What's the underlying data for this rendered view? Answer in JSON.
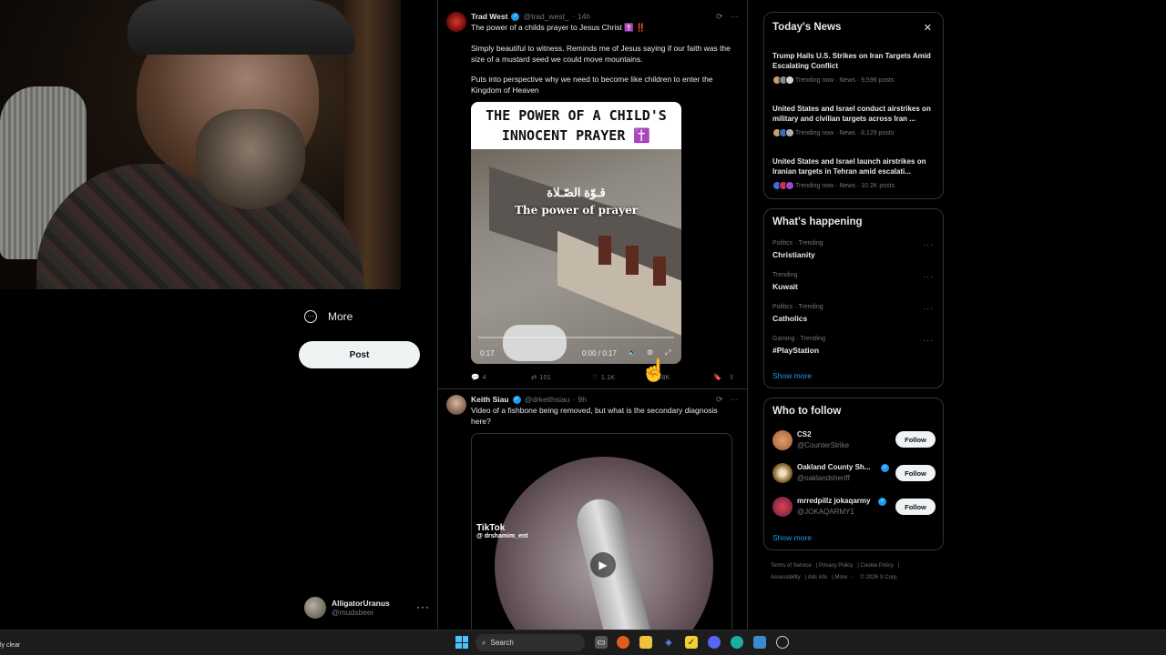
{
  "nav": {
    "more_label": "More",
    "post_label": "Post",
    "account_name": "AlligatorUranus",
    "account_handle": "@mudsbeer"
  },
  "tweets": [
    {
      "name": "Trad West",
      "handle": "@trad_west_",
      "time": "· 14h",
      "line1": "The power of a childs prayer to Jesus Christ ✝️ ‼️",
      "para2": "Simply beautiful to witness. Reminds me of Jesus saying if our faith was the size of a mustard seed we could move mountains.",
      "para3": "Puts into perspective why we need to become like children to enter the Kingdom of Heaven",
      "media_banner_l1": "THE POWER OF A CHILD'S",
      "media_banner_l2": "INNOCENT PRAYER ✝️",
      "media_overlay_ar": "قـوّة الصّـلاة",
      "media_overlay_en": "The power of prayer",
      "video_time_left": "0:17",
      "video_time": "0:00 / 0:17",
      "replies": "4",
      "reposts": "101",
      "likes": "1.1K",
      "views": "18K"
    },
    {
      "name": "Keith Siau",
      "handle": "@drkeithsiau",
      "time": "· 9h",
      "text": "Video of a fishbone being removed, but what is the secondary diagnosis here?",
      "tiktok_label": "TikTok",
      "tiktok_user": "@ drshamim_ent"
    }
  ],
  "news": {
    "title": "Today's News",
    "items": [
      {
        "title": "Trump Hails U.S. Strikes on Iran Targets Amid Escalating Conflict",
        "meta": "Trending now · News · 9,596 posts"
      },
      {
        "title": "United States and Israel conduct airstrikes on military and civilian targets across Iran ...",
        "meta": "Trending now · News · 8,129 posts"
      },
      {
        "title": "United States and Israel launch airstrikes on Iranian targets in Tehran amid escalati...",
        "meta": "Trending now · News · 10.2K posts"
      }
    ]
  },
  "happening": {
    "title": "What's happening",
    "items": [
      {
        "meta": "Politics · Trending",
        "name": "Christianity"
      },
      {
        "meta": "Trending",
        "name": "Kuwait"
      },
      {
        "meta": "Politics · Trending",
        "name": "Catholics"
      },
      {
        "meta": "Gaming · Trending",
        "name": "#PlayStation"
      }
    ],
    "show_more": "Show more"
  },
  "who_to_follow": {
    "title": "Who to follow",
    "items": [
      {
        "name": "CS2",
        "handle": "@CounterStrike",
        "button": "Follow"
      },
      {
        "name": "Oakland County Sh...",
        "handle": "@oaklandsheriff",
        "button": "Follow"
      },
      {
        "name": "mrredpillz jokaqarmy",
        "handle": "@JOKAQARMY1",
        "button": "Follow"
      }
    ],
    "show_more": "Show more"
  },
  "footer": {
    "links": [
      "Terms of Service",
      "Privacy Policy",
      "Cookie Policy",
      "Accessibility",
      "Ads info",
      "More ···",
      "© 2026 X Corp."
    ]
  },
  "taskbar": {
    "weather": "ly clear",
    "search_label": "Search"
  },
  "colors": {
    "accent": "#1d9bf0",
    "background": "#000000",
    "border": "#2f3336",
    "muted_text": "#71767b",
    "cursor": "#3ad23a"
  }
}
